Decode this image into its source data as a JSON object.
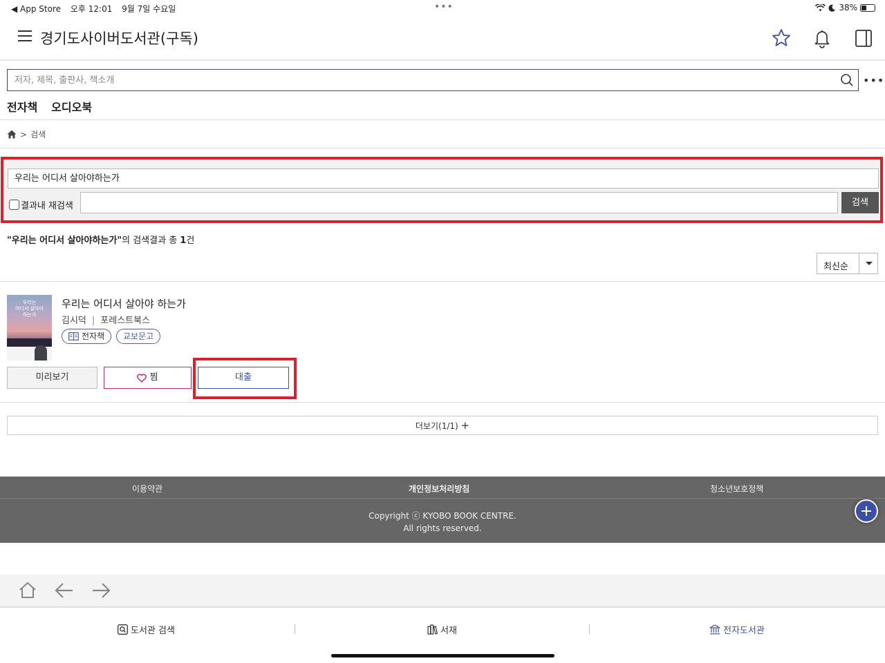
{
  "status_bar": {
    "back_app": "◀ App Store",
    "time": "오후 12:01",
    "date": "9월 7일 수요일",
    "center_dots": "•••",
    "battery": "38%",
    "battery_level": 0.38
  },
  "header": {
    "title": "경기도사이버도서관(구독)"
  },
  "search": {
    "placeholder": "저자, 제목, 출판사, 책소개",
    "more": "•••"
  },
  "category_tabs": [
    "전자책",
    "오디오북"
  ],
  "breadcrumb": {
    "separator": ">",
    "current": "검색"
  },
  "search_panel": {
    "query": "우리는 어디서 살아야하는가",
    "requery_label": "결과내 재검색",
    "requery_value": "",
    "submit_label": "검색"
  },
  "results": {
    "query_quoted": "\"우리는 어디서 살아야하는가\"",
    "suffix": "의 검색결과 총 ",
    "count": "1",
    "unit": "건"
  },
  "sort": {
    "selected": "최신순"
  },
  "book": {
    "title": "우리는 어디서 살아야 하는가",
    "cover_title": "우리는\n어디서 살아야\n하는가",
    "author": "김시덕",
    "publisher": "포레스트북스",
    "format_badge": "전자책",
    "source_badge": "교보문고",
    "preview_label": "미리보기",
    "wish_label": "찜",
    "loan_label": "대출"
  },
  "more_bar": {
    "label": "더보기(1/1)",
    "icon": "+"
  },
  "footer": {
    "links": [
      "이용약관",
      "개인정보처리방침",
      "청소년보호정책"
    ],
    "copyright_line1": "Copyright ⓒ KYOBO BOOK CENTRE.",
    "copyright_line2": "All rights reserved."
  },
  "bottom_tabs": {
    "library_search": "도서관 검색",
    "bookshelf": "서재",
    "e_library": "전자도서관",
    "active": "전자도서관"
  },
  "colors": {
    "accent": "#3d4fa3",
    "highlight_red": "#d7232d",
    "wish_pink": "#c0306a",
    "footer_bg": "#666666"
  }
}
